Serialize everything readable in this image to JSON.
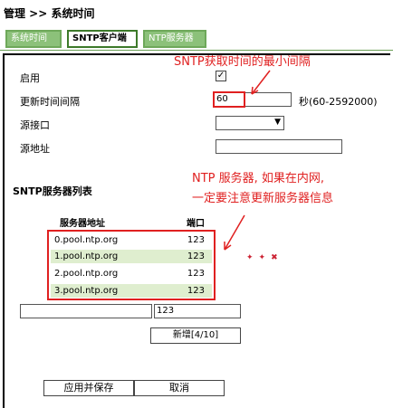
{
  "breadcrumb": "管理 >> 系统时间",
  "tabs": [
    {
      "label": "系统时间",
      "active": false
    },
    {
      "label": "SNTP客户端",
      "active": true
    },
    {
      "label": "NTP服务器",
      "active": false
    }
  ],
  "form": {
    "enable_label": "启用",
    "enable_checked": "✓",
    "interval_label": "更新时间间隔",
    "interval_value": "60",
    "interval_hint": "秒(60-2592000)",
    "port_label": "源接口",
    "address_label": "源地址"
  },
  "annotations": {
    "interval_note": "SNTP获取时间的最小间隔",
    "server_note_line1": "NTP 服务器, 如果在内网,",
    "server_note_line2": "一定要注意更新服务器信息"
  },
  "server_list": {
    "title": "SNTP服务器列表",
    "col_address": "服务器地址",
    "col_port": "端口",
    "rows": [
      {
        "address": "0.pool.ntp.org",
        "port": "123"
      },
      {
        "address": "1.pool.ntp.org",
        "port": "123"
      },
      {
        "address": "2.pool.ntp.org",
        "port": "123"
      },
      {
        "address": "3.pool.ntp.org",
        "port": "123"
      }
    ],
    "new_port_value": "123",
    "add_button": "新增[4/10]"
  },
  "actions": {
    "apply": "应用并保存",
    "cancel": "取消"
  },
  "colors": {
    "annotation": "#e02020",
    "row_alt": "#dfeecf",
    "tab_green": "#8cc17a"
  }
}
